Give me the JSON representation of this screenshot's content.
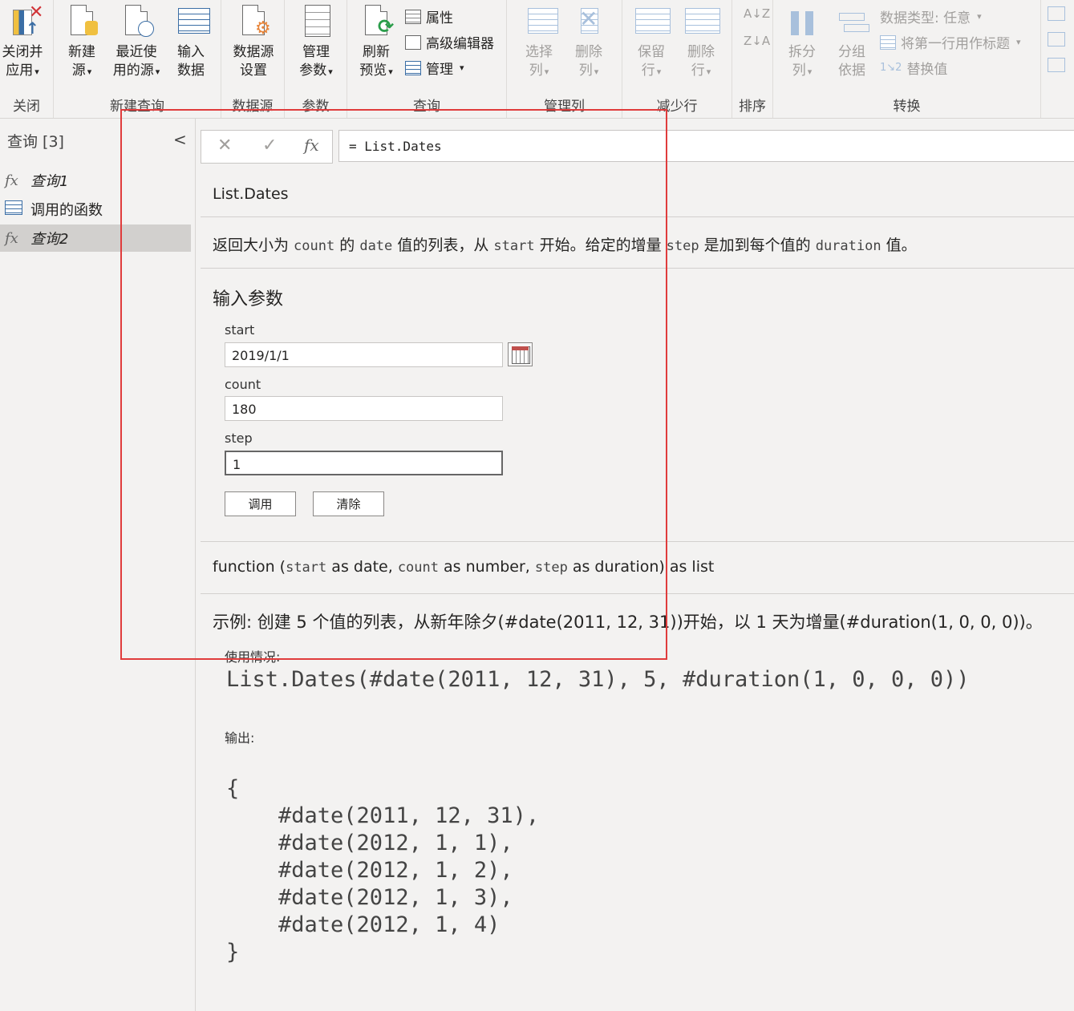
{
  "ribbon": {
    "groups": {
      "close": "关闭",
      "new_query": "新建查询",
      "data_source": "数据源",
      "params": "参数",
      "query": "查询",
      "manage_cols": "管理列",
      "reduce_rows": "减少行",
      "sort": "排序",
      "transform": "转换"
    },
    "buttons": {
      "close_apply_1": "关闭并",
      "close_apply_2": "应用",
      "new_source_1": "新建",
      "new_source_2": "源",
      "recent_1": "最近使",
      "recent_2": "用的源",
      "enter_data_1": "输入",
      "enter_data_2": "数据",
      "ds_settings_1": "数据源",
      "ds_settings_2": "设置",
      "manage_params_1": "管理",
      "manage_params_2": "参数",
      "refresh_1": "刷新",
      "refresh_2": "预览",
      "properties": "属性",
      "advanced_editor": "高级编辑器",
      "manage": "管理",
      "choose_cols_1": "选择",
      "choose_cols_2": "列",
      "remove_cols_1": "删除",
      "remove_cols_2": "列",
      "keep_rows_1": "保留",
      "keep_rows_2": "行",
      "remove_rows_1": "删除",
      "remove_rows_2": "行",
      "split_1": "拆分",
      "split_2": "列",
      "group_1": "分组",
      "group_2": "依据",
      "data_type": "数据类型: 任意",
      "first_row_header": "将第一行用作标题",
      "replace_values": "替换值"
    }
  },
  "queries": {
    "title": "查询 [3]",
    "items": [
      {
        "label": "查询1",
        "icon": "fx-icon"
      },
      {
        "label": "调用的函数",
        "icon": "table-icon"
      },
      {
        "label": "查询2",
        "icon": "fx-icon"
      }
    ]
  },
  "formula": {
    "text": "= List.Dates"
  },
  "function": {
    "name": "List.Dates",
    "desc_1": "返回大小为 ",
    "desc_count": "count",
    "desc_2": " 的 ",
    "desc_date": "date",
    "desc_3": " 值的列表，从 ",
    "desc_start": "start",
    "desc_4": " 开始。给定的增量 ",
    "desc_step": "step",
    "desc_5": " 是加到每个值的 ",
    "desc_duration": "duration",
    "desc_6": " 值。",
    "params_title": "输入参数",
    "params": {
      "start_label": "start",
      "start_value": "2019/1/1",
      "count_label": "count",
      "count_value": "180",
      "step_label": "step",
      "step_value": "1"
    },
    "invoke": "调用",
    "clear": "清除",
    "sig_1": "function (",
    "sig_start": "start",
    "sig_2": " as date, ",
    "sig_count": "count",
    "sig_3": " as number, ",
    "sig_step": "step",
    "sig_4": " as duration) as list",
    "example_title": "示例: 创建 5 个值的列表，从新年除夕(#date(2011, 12, 31))开始，以 1 天为增量(#duration(1, 0, 0, 0))。",
    "usage_label": "使用情况:",
    "usage_code": "List.Dates(#date(2011, 12, 31), 5, #duration(1, 0, 0, 0))",
    "output_label": "输出:",
    "output_lines": [
      "{",
      "    #date(2011, 12, 31),",
      "    #date(2012, 1, 1),",
      "    #date(2012, 1, 2),",
      "    #date(2012, 1, 3),",
      "    #date(2012, 1, 4)",
      "}"
    ]
  }
}
